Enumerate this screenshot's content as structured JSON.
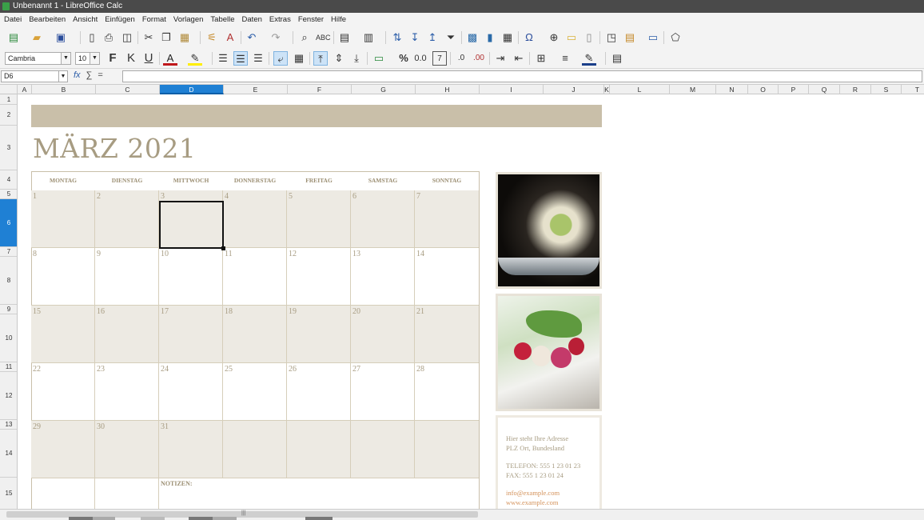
{
  "window": {
    "title": "Unbenannt 1 - LibreOffice Calc"
  },
  "menu": [
    "Datei",
    "Bearbeiten",
    "Ansicht",
    "Einfügen",
    "Format",
    "Vorlagen",
    "Tabelle",
    "Daten",
    "Extras",
    "Fenster",
    "Hilfe"
  ],
  "format_bar": {
    "font_name": "Cambria",
    "font_size": "10",
    "bold": "F",
    "italic": "K",
    "underline": "U"
  },
  "formula_bar": {
    "cell_ref": "D6",
    "fx": "fx",
    "sum": "∑",
    "equals": "=",
    "content": ""
  },
  "columns": [
    "A",
    "B",
    "C",
    "D",
    "E",
    "F",
    "G",
    "H",
    "I",
    "J",
    "K",
    "L",
    "M",
    "N",
    "O",
    "P",
    "Q",
    "R",
    "S",
    "T"
  ],
  "rows": [
    "1",
    "2",
    "3",
    "4",
    "5",
    "6",
    "7",
    "8",
    "9",
    "10",
    "11",
    "12",
    "13",
    "14",
    "15"
  ],
  "selected": {
    "column": "D",
    "row": "6"
  },
  "calendar": {
    "month_title": "MÄRZ 2021",
    "weekdays": [
      "MONTAG",
      "DIENSTAG",
      "MITTWOCH",
      "DONNERSTAG",
      "FREITAG",
      "SAMSTAG",
      "SONNTAG"
    ],
    "weeks": [
      [
        "1",
        "2",
        "3",
        "4",
        "5",
        "6",
        "7"
      ],
      [
        "8",
        "9",
        "10",
        "11",
        "12",
        "13",
        "14"
      ],
      [
        "15",
        "16",
        "17",
        "18",
        "19",
        "20",
        "21"
      ],
      [
        "22",
        "23",
        "24",
        "25",
        "26",
        "27",
        "28"
      ],
      [
        "29",
        "30",
        "31",
        "",
        "",
        "",
        ""
      ]
    ],
    "notes_label": "NOTIZEN:"
  },
  "contact": {
    "address_line1": "Hier steht Ihre Adresse",
    "address_line2": "PLZ Ort, Bundesland",
    "phone": "TELEFON: 555 1 23 01 23",
    "fax": "FAX: 555 1 23 01 24",
    "email": "info@example.com",
    "web": "www.example.com"
  },
  "colors": {
    "accent": "#c9bfa9",
    "text_accent": "#a79c82",
    "shade": "#edeae3",
    "link": "#d4925a",
    "selection": "#1f80d4"
  }
}
